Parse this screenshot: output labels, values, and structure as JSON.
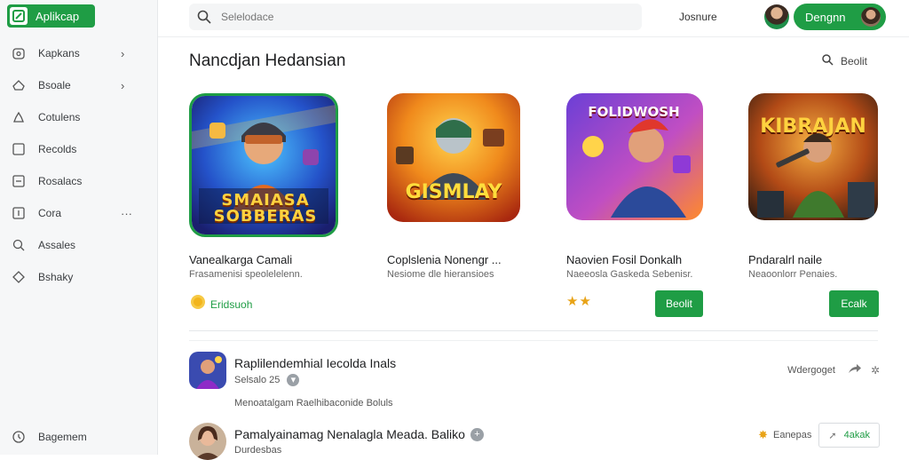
{
  "brand": {
    "label": "Aplikcap"
  },
  "sidebar": {
    "items": [
      {
        "label": "Kapkans",
        "icon": "clock-icon",
        "trail": "›"
      },
      {
        "label": "Bsoale",
        "icon": "home-icon",
        "trail": "›"
      },
      {
        "label": "Cotulens",
        "icon": "upload-icon",
        "trail": ""
      },
      {
        "label": "Recolds",
        "icon": "square-icon",
        "trail": ""
      },
      {
        "label": "Rosalacs",
        "icon": "list-icon",
        "trail": ""
      },
      {
        "label": "Cora",
        "icon": "text-icon",
        "trail": "···"
      },
      {
        "label": "Assales",
        "icon": "search-icon",
        "trail": ""
      },
      {
        "label": "Bshaky",
        "icon": "tag-icon",
        "trail": ""
      }
    ],
    "footer": {
      "label": "Bagemem",
      "icon": "clock-icon"
    }
  },
  "topbar": {
    "search_placeholder": "Selelodace",
    "link": "Josnure",
    "user_button": "Dengnn"
  },
  "section": {
    "title": "Nancdjan Hedansian",
    "action": "Beolit"
  },
  "cards": [
    {
      "art_text": "SMAIASA\nSOBBERAS",
      "title": "Vanealkarga Camali",
      "subtitle": "Frasamenisi speolelelenn.",
      "rating_label": "Eridsuoh",
      "rating_type": "badge",
      "stars": "",
      "button": ""
    },
    {
      "art_text": "GISMLAY",
      "title": "Coplslenia Nonengr ...",
      "subtitle": "Nesiome dle hieransioes",
      "rating_label": "",
      "rating_type": "none",
      "stars": "",
      "button": ""
    },
    {
      "art_text": "FOLIDWOSH",
      "title": "Naovien Fosil Donkalh",
      "subtitle": "Naeeosla Gaskeda Sebenisr.",
      "rating_label": "",
      "rating_type": "stars",
      "stars": "★★",
      "button": "Beolit"
    },
    {
      "art_text": "KIBRAJAN",
      "title": "Pndaralrl naile",
      "subtitle": "Neaoonlorr Penaies.",
      "rating_label": "",
      "rating_type": "none",
      "stars": "",
      "button": "Ecalk"
    }
  ],
  "list": [
    {
      "title": "Raplilendemhial Iecolda Inals",
      "meta": "Selsalo 25",
      "desc": "Menoatalgam Raelhibaconide Boluls",
      "right_label": "Wdergoget",
      "right_icons": [
        "share-icon",
        "dots-icon"
      ]
    },
    {
      "title": "Pamalyainamag Nenalagla Meada. Baliko",
      "meta": "Durdesbas",
      "desc": "",
      "right_label": "Eanepas",
      "right_button": "4akak"
    }
  ],
  "colors": {
    "accent": "#1f9d45",
    "star": "#e8a317"
  }
}
